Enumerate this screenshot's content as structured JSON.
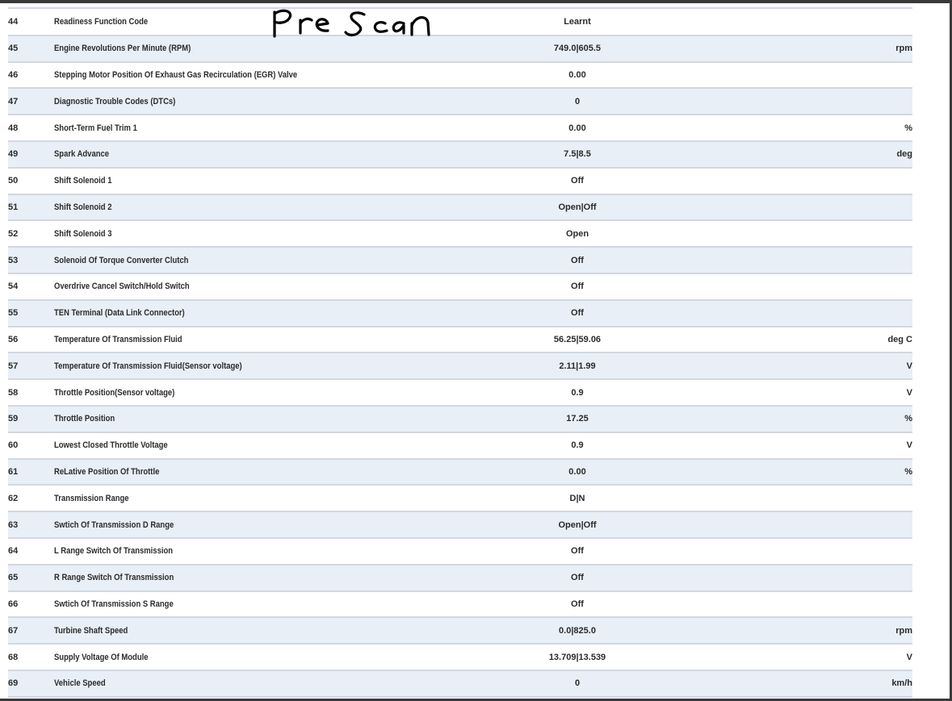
{
  "annotation": {
    "handwritten_text": "Pre Scan"
  },
  "rows": [
    {
      "num": "44",
      "name": "Readiness Function Code",
      "value": "Learnt",
      "unit": ""
    },
    {
      "num": "45",
      "name": "Engine Revolutions Per Minute (RPM)",
      "value": "749.0|605.5",
      "unit": "rpm"
    },
    {
      "num": "46",
      "name": "Stepping Motor Position Of Exhaust Gas Recirculation (EGR) Valve",
      "value": "0.00",
      "unit": ""
    },
    {
      "num": "47",
      "name": "Diagnostic Trouble Codes (DTCs)",
      "value": "0",
      "unit": ""
    },
    {
      "num": "48",
      "name": "Short-Term Fuel Trim 1",
      "value": "0.00",
      "unit": "%"
    },
    {
      "num": "49",
      "name": "Spark Advance",
      "value": "7.5|8.5",
      "unit": "deg"
    },
    {
      "num": "50",
      "name": "Shift Solenoid 1",
      "value": "Off",
      "unit": ""
    },
    {
      "num": "51",
      "name": "Shift Solenoid 2",
      "value": "Open|Off",
      "unit": ""
    },
    {
      "num": "52",
      "name": "Shift Solenoid 3",
      "value": "Open",
      "unit": ""
    },
    {
      "num": "53",
      "name": "Solenoid Of Torque Converter Clutch",
      "value": "Off",
      "unit": ""
    },
    {
      "num": "54",
      "name": "Overdrive Cancel Switch/Hold Switch",
      "value": "Off",
      "unit": ""
    },
    {
      "num": "55",
      "name": "TEN Terminal (Data Link Connector)",
      "value": "Off",
      "unit": ""
    },
    {
      "num": "56",
      "name": "Temperature Of Transmission Fluid",
      "value": "56.25|59.06",
      "unit": "deg C"
    },
    {
      "num": "57",
      "name": "Temperature Of Transmission Fluid(Sensor voltage)",
      "value": "2.11|1.99",
      "unit": "V"
    },
    {
      "num": "58",
      "name": "Throttle Position(Sensor voltage)",
      "value": "0.9",
      "unit": "V"
    },
    {
      "num": "59",
      "name": "Throttle Position",
      "value": "17.25",
      "unit": "%"
    },
    {
      "num": "60",
      "name": "Lowest Closed Throttle Voltage",
      "value": "0.9",
      "unit": "V"
    },
    {
      "num": "61",
      "name": "ReLative Position Of Throttle",
      "value": "0.00",
      "unit": "%"
    },
    {
      "num": "62",
      "name": "Transmission Range",
      "value": "D|N",
      "unit": ""
    },
    {
      "num": "63",
      "name": "Swtich Of Transmission D Range",
      "value": "Open|Off",
      "unit": ""
    },
    {
      "num": "64",
      "name": "L Range Switch Of Transmission",
      "value": "Off",
      "unit": ""
    },
    {
      "num": "65",
      "name": "R Range Switch Of Transmission",
      "value": "Off",
      "unit": ""
    },
    {
      "num": "66",
      "name": "Swtich Of Transmission S Range",
      "value": "Off",
      "unit": ""
    },
    {
      "num": "67",
      "name": "Turbine Shaft Speed",
      "value": "0.0|825.0",
      "unit": "rpm"
    },
    {
      "num": "68",
      "name": "Supply Voltage Of Module",
      "value": "13.709|13.539",
      "unit": "V"
    },
    {
      "num": "69",
      "name": "Vehicle Speed",
      "value": "0",
      "unit": "km/h"
    }
  ]
}
